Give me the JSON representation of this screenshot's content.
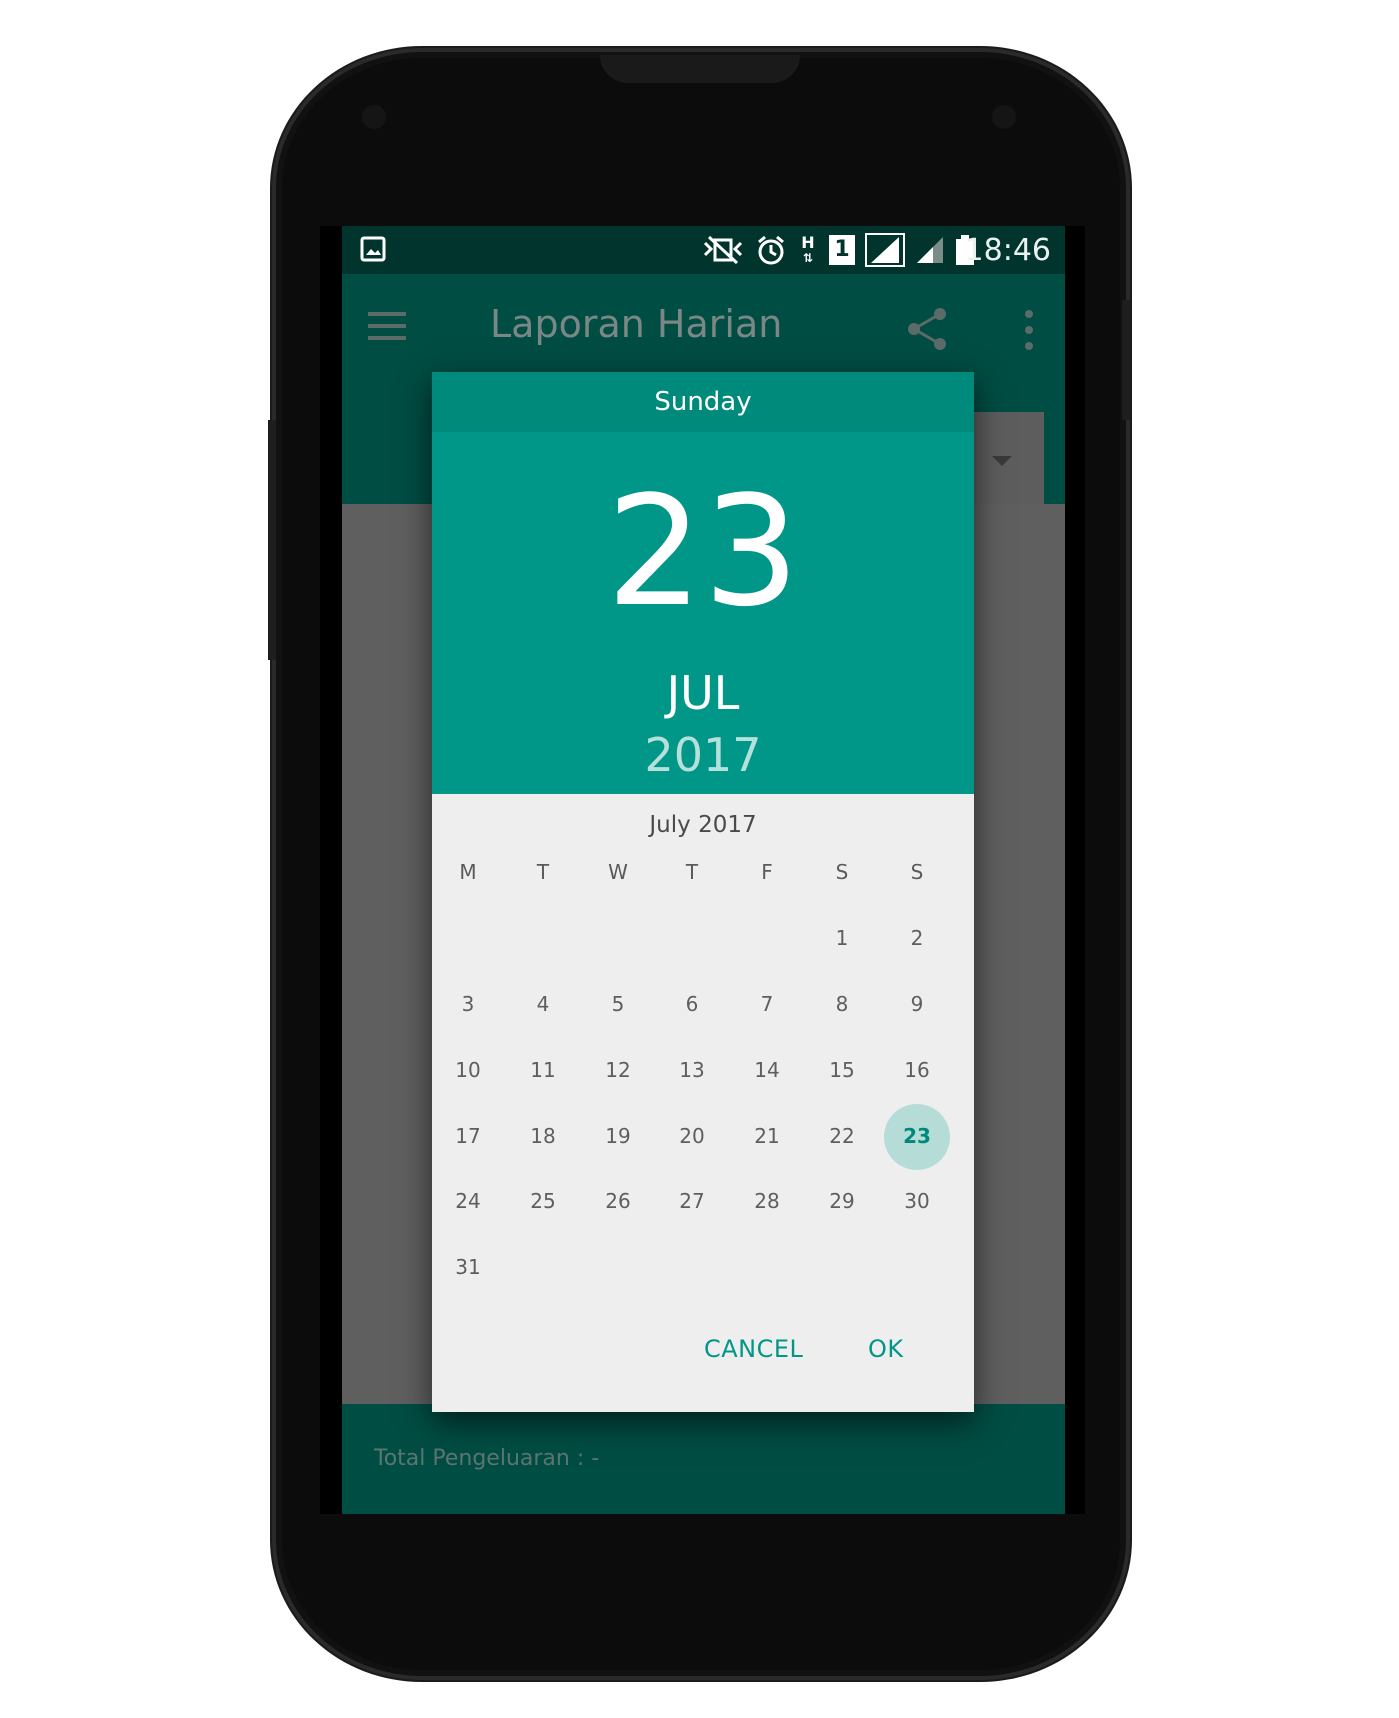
{
  "status_bar": {
    "time": "18:46",
    "sim_label": "1",
    "network_label": "H"
  },
  "app_bar": {
    "title": "Laporan Harian"
  },
  "footer": {
    "total_label": "Total Pengeluaran :  -"
  },
  "date_picker": {
    "weekday": "Sunday",
    "day": "23",
    "month": "JUL",
    "year": "2017",
    "month_title": "July 2017",
    "weekday_headers": [
      "M",
      "T",
      "W",
      "T",
      "F",
      "S",
      "S"
    ],
    "weeks": [
      [
        "",
        "",
        "",
        "",
        "",
        "1",
        "2"
      ],
      [
        "3",
        "4",
        "5",
        "6",
        "7",
        "8",
        "9"
      ],
      [
        "10",
        "11",
        "12",
        "13",
        "14",
        "15",
        "16"
      ],
      [
        "17",
        "18",
        "19",
        "20",
        "21",
        "22",
        "23"
      ],
      [
        "24",
        "25",
        "26",
        "27",
        "28",
        "29",
        "30"
      ],
      [
        "31",
        "",
        "",
        "",
        "",
        "",
        ""
      ]
    ],
    "selected_day": "23",
    "cancel_label": "CANCEL",
    "ok_label": "OK"
  },
  "colors": {
    "accent": "#009688",
    "header_dark": "#008a7b",
    "app_bar": "#004d43",
    "status_bar": "#00342d",
    "selected_circle": "#b5dcd7"
  }
}
